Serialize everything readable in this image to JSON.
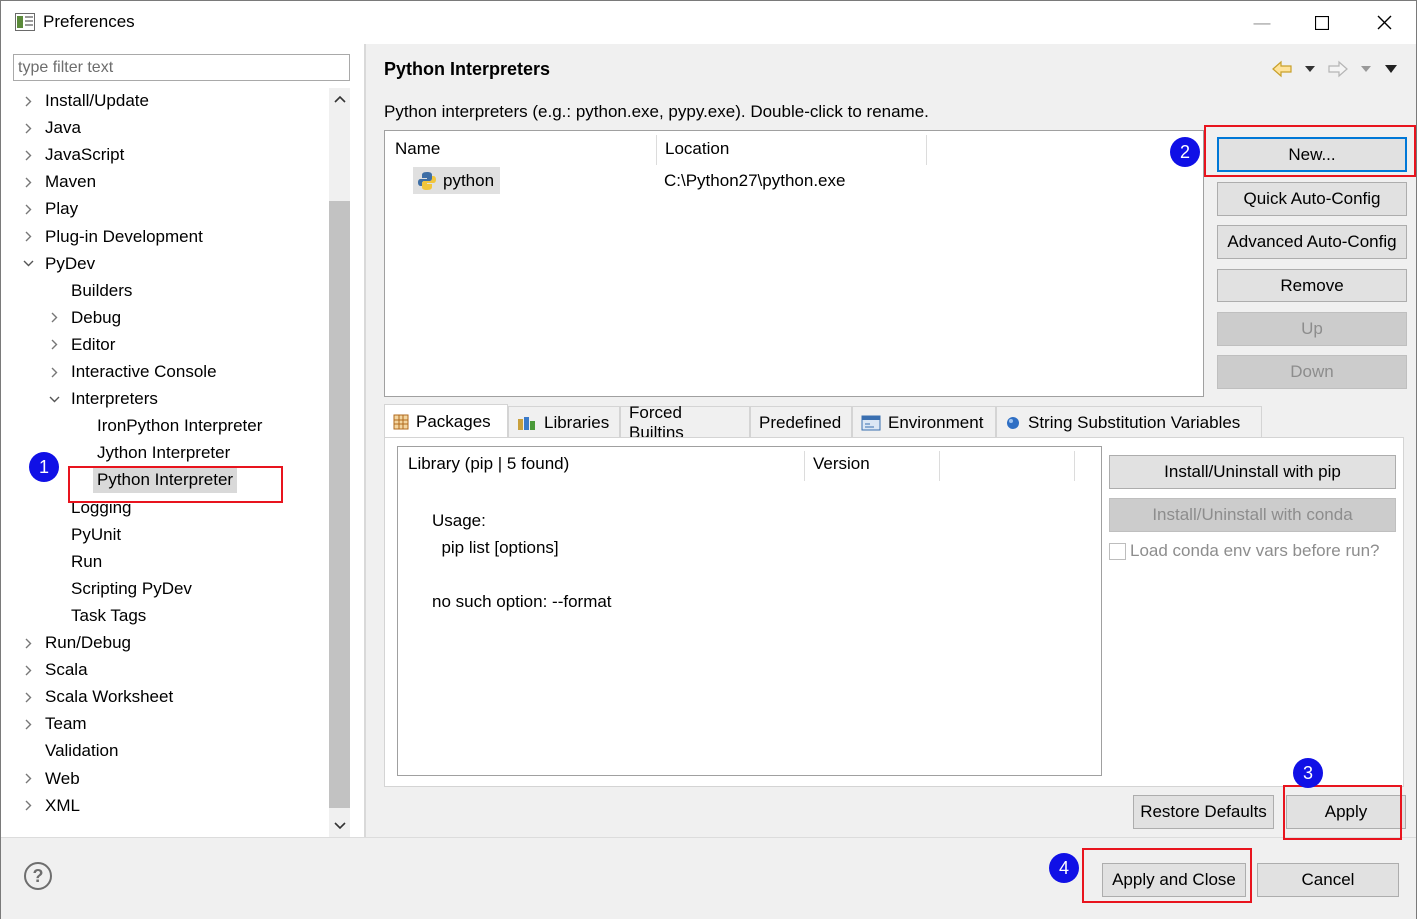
{
  "window": {
    "title": "Preferences",
    "minimize_glyph": "—",
    "maximize_glyph": "☐",
    "close_glyph": "✕"
  },
  "sidebar": {
    "filter_placeholder": "type filter text",
    "items": [
      {
        "label": "Install/Update",
        "level": 0,
        "expand": "collapsed"
      },
      {
        "label": "Java",
        "level": 0,
        "expand": "collapsed"
      },
      {
        "label": "JavaScript",
        "level": 0,
        "expand": "collapsed"
      },
      {
        "label": "Maven",
        "level": 0,
        "expand": "collapsed"
      },
      {
        "label": "Play",
        "level": 0,
        "expand": "collapsed"
      },
      {
        "label": "Plug-in Development",
        "level": 0,
        "expand": "collapsed"
      },
      {
        "label": "PyDev",
        "level": 0,
        "expand": "expanded"
      },
      {
        "label": "Builders",
        "level": 1,
        "expand": "none"
      },
      {
        "label": "Debug",
        "level": 1,
        "expand": "collapsed"
      },
      {
        "label": "Editor",
        "level": 1,
        "expand": "collapsed"
      },
      {
        "label": "Interactive Console",
        "level": 1,
        "expand": "collapsed"
      },
      {
        "label": "Interpreters",
        "level": 1,
        "expand": "expanded"
      },
      {
        "label": "IronPython Interpreter",
        "level": 2,
        "expand": "none"
      },
      {
        "label": "Jython Interpreter",
        "level": 2,
        "expand": "none"
      },
      {
        "label": "Python Interpreter",
        "level": 2,
        "expand": "none",
        "selected": true
      },
      {
        "label": "Logging",
        "level": 1,
        "expand": "none"
      },
      {
        "label": "PyUnit",
        "level": 1,
        "expand": "none"
      },
      {
        "label": "Run",
        "level": 1,
        "expand": "none"
      },
      {
        "label": "Scripting PyDev",
        "level": 1,
        "expand": "none"
      },
      {
        "label": "Task Tags",
        "level": 1,
        "expand": "none"
      },
      {
        "label": "Run/Debug",
        "level": 0,
        "expand": "collapsed"
      },
      {
        "label": "Scala",
        "level": 0,
        "expand": "collapsed"
      },
      {
        "label": "Scala Worksheet",
        "level": 0,
        "expand": "collapsed"
      },
      {
        "label": "Team",
        "level": 0,
        "expand": "collapsed"
      },
      {
        "label": "Validation",
        "level": 0,
        "expand": "none"
      },
      {
        "label": "Web",
        "level": 0,
        "expand": "collapsed"
      },
      {
        "label": "XML",
        "level": 0,
        "expand": "collapsed"
      }
    ]
  },
  "main": {
    "title": "Python Interpreters",
    "description": "Python interpreters (e.g.: python.exe, pypy.exe).   Double-click to rename.",
    "table": {
      "columns": [
        "Name",
        "Location"
      ],
      "rows": [
        {
          "name": "python",
          "location": "C:\\Python27\\python.exe"
        }
      ]
    },
    "side_buttons": {
      "new": "New...",
      "quick": "Quick Auto-Config",
      "advanced": "Advanced Auto-Config",
      "remove": "Remove",
      "up": "Up",
      "down": "Down"
    },
    "tabs": [
      {
        "label": "Packages",
        "icon": "packages-icon",
        "active": true
      },
      {
        "label": "Libraries",
        "icon": "libraries-icon"
      },
      {
        "label": "Forced Builtins"
      },
      {
        "label": "Predefined"
      },
      {
        "label": "Environment",
        "icon": "environment-icon"
      },
      {
        "label": "String Substitution Variables",
        "icon": "variables-icon"
      }
    ],
    "packages": {
      "columns": [
        "Library (pip | 5 found)",
        "Version"
      ],
      "usage_lines": [
        "Usage:",
        "  pip list [options]",
        "",
        "no such option: --format"
      ],
      "pip_button": "Install/Uninstall with pip",
      "conda_button": "Install/Uninstall with conda",
      "conda_checkbox": "Load conda env vars before run?"
    },
    "restore_defaults": "Restore Defaults",
    "apply": "Apply"
  },
  "footer": {
    "help_glyph": "?",
    "apply_close": "Apply and Close",
    "cancel": "Cancel"
  },
  "annotations": {
    "badges": [
      "1",
      "2",
      "3",
      "4"
    ],
    "badge_color": "#1010e6",
    "highlight_color": "#e8141e"
  }
}
